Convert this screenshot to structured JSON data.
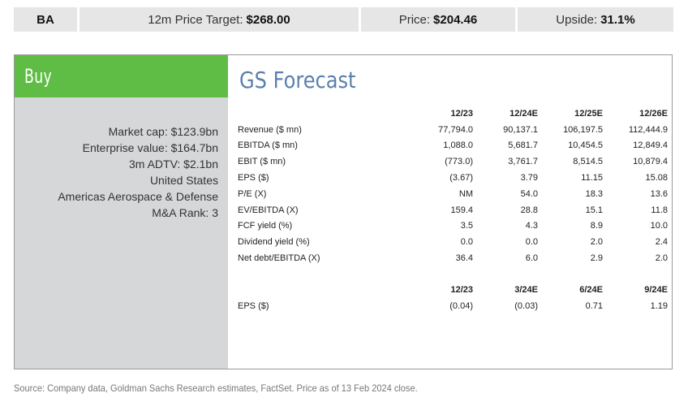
{
  "header": {
    "ticker": "BA",
    "price_target_label": "12m Price Target:",
    "price_target_value": "$268.00",
    "price_label": "Price:",
    "price_value": "$204.46",
    "upside_label": "Upside:",
    "upside_value": "31.1%"
  },
  "rating": "Buy",
  "company_info": [
    "Market cap: $123.9bn",
    "Enterprise value: $164.7bn",
    "3m ADTV: $2.1bn",
    "United States",
    "Americas Aerospace & Defense",
    "M&A Rank: 3"
  ],
  "forecast_title": "GS Forecast",
  "annual": {
    "columns": [
      "12/23",
      "12/24E",
      "12/25E",
      "12/26E"
    ],
    "rows": [
      {
        "label": "Revenue ($ mn)",
        "values": [
          "77,794.0",
          "90,137.1",
          "106,197.5",
          "112,444.9"
        ]
      },
      {
        "label": "EBITDA ($ mn)",
        "values": [
          "1,088.0",
          "5,681.7",
          "10,454.5",
          "12,849.4"
        ]
      },
      {
        "label": "EBIT ($ mn)",
        "values": [
          "(773.0)",
          "3,761.7",
          "8,514.5",
          "10,879.4"
        ]
      },
      {
        "label": "EPS ($)",
        "values": [
          "(3.67)",
          "3.79",
          "11.15",
          "15.08"
        ]
      },
      {
        "label": "P/E (X)",
        "values": [
          "NM",
          "54.0",
          "18.3",
          "13.6"
        ]
      },
      {
        "label": "EV/EBITDA (X)",
        "values": [
          "159.4",
          "28.8",
          "15.1",
          "11.8"
        ]
      },
      {
        "label": "FCF yield (%)",
        "values": [
          "3.5",
          "4.3",
          "8.9",
          "10.0"
        ]
      },
      {
        "label": "Dividend yield (%)",
        "values": [
          "0.0",
          "0.0",
          "2.0",
          "2.4"
        ]
      },
      {
        "label": "Net debt/EBITDA (X)",
        "values": [
          "36.4",
          "6.0",
          "2.9",
          "2.0"
        ]
      }
    ]
  },
  "quarterly": {
    "columns": [
      "12/23",
      "3/24E",
      "6/24E",
      "9/24E"
    ],
    "rows": [
      {
        "label": "EPS ($)",
        "values": [
          "(0.04)",
          "(0.03)",
          "0.71",
          "1.19"
        ]
      }
    ]
  },
  "source": "Source: Company data, Goldman Sachs Research estimates, FactSet. Price as of 13 Feb 2024 close."
}
